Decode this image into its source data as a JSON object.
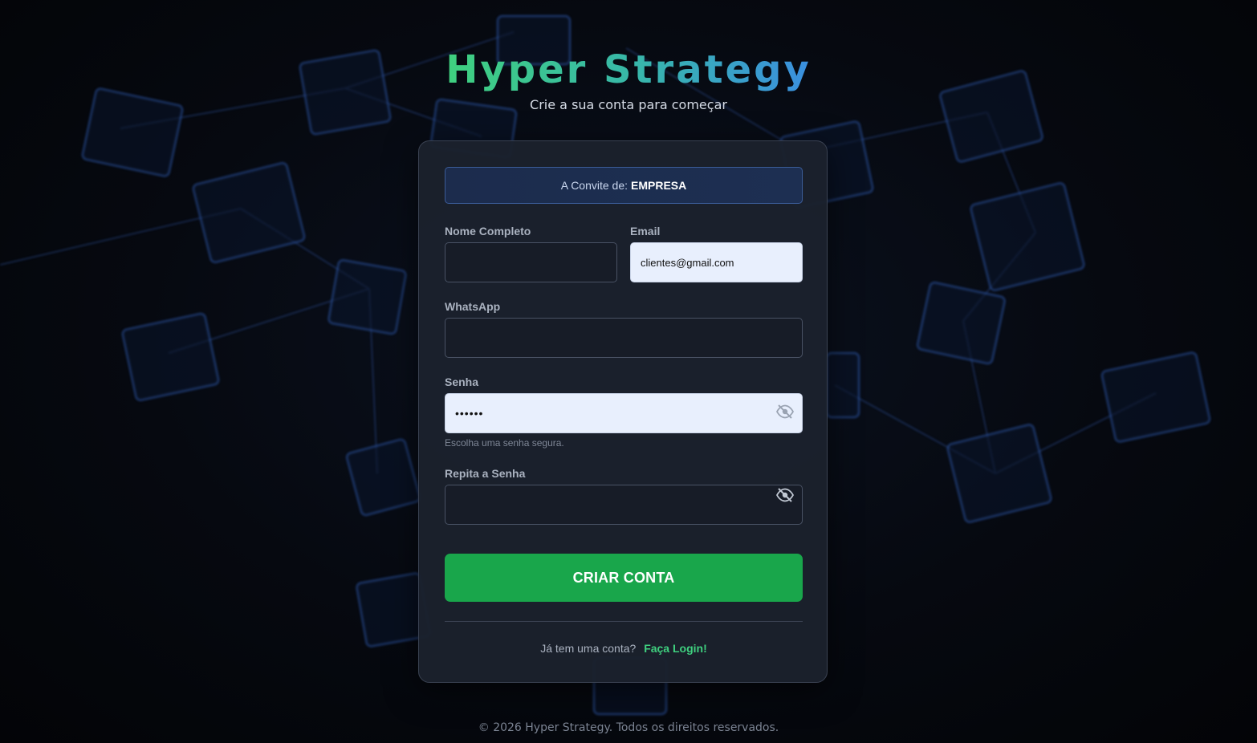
{
  "brand": {
    "title": "Hyper Strategy",
    "subtitle": "Crie a sua conta para começar"
  },
  "invite": {
    "prefix": "A Convite de:",
    "company": "EMPRESA"
  },
  "form": {
    "name": {
      "label": "Nome Completo",
      "value": ""
    },
    "email": {
      "label": "Email",
      "value": "clientes@gmail.com"
    },
    "whatsapp": {
      "label": "WhatsApp",
      "value": ""
    },
    "password": {
      "label": "Senha",
      "value": "••••••",
      "hint": "Escolha uma senha segura.",
      "toggle_icon": "eye-off-icon"
    },
    "confirm_password": {
      "label": "Repita a Senha",
      "value": "",
      "toggle_icon": "eye-off-icon"
    },
    "submit_label": "CRIAR CONTA"
  },
  "login": {
    "prompt": "Já tem uma conta?",
    "link_label": "Faça Login!"
  },
  "footer": {
    "copyright": "© 2026 Hyper Strategy. Todos os direitos reservados."
  },
  "colors": {
    "accent_green": "#19a64b",
    "link_green": "#3fd07f",
    "title_gradient_start": "#3fd07f",
    "title_gradient_end": "#3a8fe0",
    "card_bg": "#1b212d",
    "invite_bg": "#1c2c4d",
    "autofill_bg": "#e8effd"
  }
}
